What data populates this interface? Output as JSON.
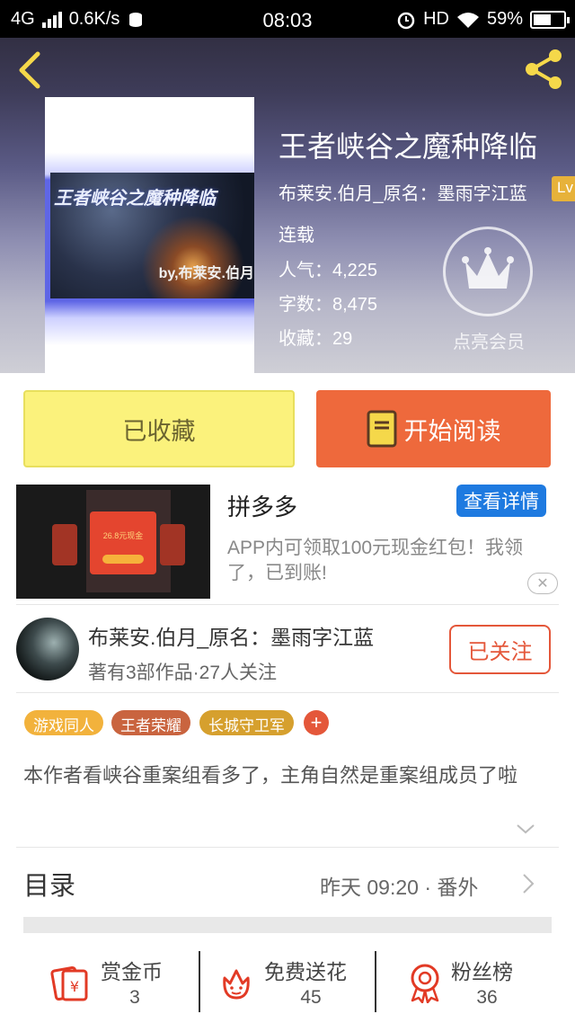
{
  "status_bar": {
    "network": "4G",
    "speed": "0.6K/s",
    "time": "08:03",
    "hd": "HD",
    "battery": "59%",
    "battery_level": 0.59
  },
  "book": {
    "title": "王者峡谷之魔种降临",
    "author_line": "布莱安.伯月_原名：墨雨字江蓝",
    "level_badge": "Lv",
    "status": "连载",
    "popularity": "人气：4,225",
    "word_count": "字数：8,475",
    "favorites": "收藏：29",
    "member_label": "点亮会员",
    "cover": {
      "title_text": "王者峡谷之魔种降临",
      "author_text": "by,布莱安.伯月"
    }
  },
  "actions": {
    "collected_label": "已收藏",
    "read_label": "开始阅读"
  },
  "ad": {
    "title": "拼多多",
    "detail_button": "查看详情",
    "description": "APP内可领取100元现金红包！我领了，已到账!",
    "image_amount": "26.8元现金"
  },
  "author": {
    "name": "布莱安.伯月_原名：墨雨字江蓝",
    "info": "著有3部作品·27人关注",
    "follow_label": "已关注"
  },
  "tags": [
    {
      "label": "游戏同人",
      "color": "#f2b23c"
    },
    {
      "label": "王者荣耀",
      "color": "#c9643f"
    },
    {
      "label": "长城守卫军",
      "color": "#d6a02e"
    }
  ],
  "tag_add": "+",
  "synopsis": "本作者看峡谷重案组看多了，主角自然是重案组成员了啦",
  "toc": {
    "label": "目录",
    "latest": "昨天 09:20 · 番外"
  },
  "bottom_bar": [
    {
      "label": "赏金币",
      "value": "3",
      "icon": "reward-coin-icon"
    },
    {
      "label": "免费送花",
      "value": "45",
      "icon": "flower-icon"
    },
    {
      "label": "粉丝榜",
      "value": "36",
      "icon": "fan-medal-icon"
    }
  ],
  "colors": {
    "accent": "#ee693c",
    "collected_bg": "#fbf27c",
    "icon_red": "#e23a25",
    "ad_button": "#1e7ae0"
  }
}
